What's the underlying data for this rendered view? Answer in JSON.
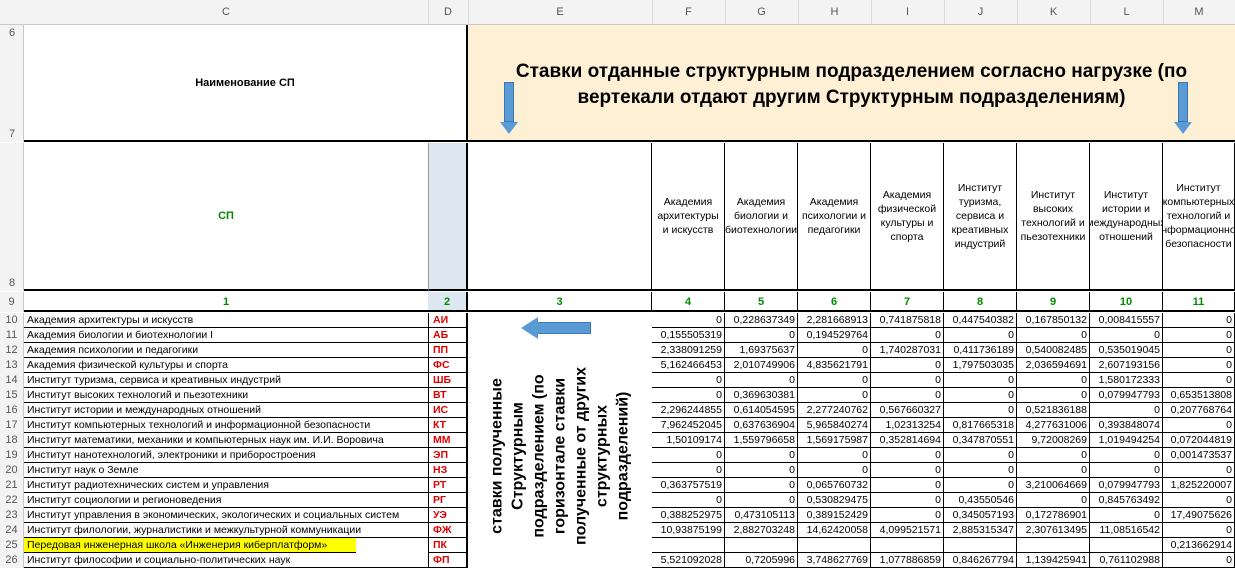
{
  "col_headers": [
    "C",
    "D",
    "E",
    "F",
    "G",
    "H",
    "I",
    "J",
    "K",
    "L",
    "M"
  ],
  "row_numbers": {
    "r6": "6",
    "r7": "7",
    "r8": "8",
    "r9": "9"
  },
  "header": {
    "name_sp": "Наименование СП",
    "sp": "СП",
    "banner_line1": "Ставки отданные структурным подразделением согласно нагрузке (по",
    "banner_line2": "вертекали отдают другим Структурным подразделениям)",
    "vertical_note": "ставки полученные Структурным подразделением (по горизонтале ставки полученные от других структурных подразделений)"
  },
  "columns": [
    {
      "label": "Академия архитектуры и искусств",
      "num": "4"
    },
    {
      "label": "Академия биологии и биотехнологии",
      "num": "5"
    },
    {
      "label": "Академия психологии и педагогики",
      "num": "6"
    },
    {
      "label": "Академия физической культуры и спорта",
      "num": "7"
    },
    {
      "label": "Институт туризма, сервиса и креативных индустрий",
      "num": "8"
    },
    {
      "label": "Институт высоких технологий и пьезотехники",
      "num": "9"
    },
    {
      "label": "Институт истории и международных отношений",
      "num": "10"
    },
    {
      "label": "Институт компьютерных технологий и информационной безопасности",
      "num": "11"
    }
  ],
  "index_row": {
    "c": "1",
    "d": "2",
    "e": "3"
  },
  "rows": [
    {
      "n": "10",
      "name": "Академия архитектуры и искусств",
      "code": "АИ",
      "v": [
        "0",
        "0,228637349",
        "2,281668913",
        "0,741875818",
        "0,447540382",
        "0,167850132",
        "0,008415557",
        "0"
      ]
    },
    {
      "n": "11",
      "name": "Академия биологии и биотехнологии I",
      "code": "АБ",
      "v": [
        "0,155505319",
        "0",
        "0,194529764",
        "0",
        "0",
        "0",
        "0",
        "0"
      ]
    },
    {
      "n": "12",
      "name": "Академия психологии и педагогики",
      "code": "ПП",
      "v": [
        "2,338091259",
        "1,69375637",
        "0",
        "1,740287031",
        "0,411736189",
        "0,540082485",
        "0,535019045",
        "0"
      ]
    },
    {
      "n": "13",
      "name": "Академия физической культуры и спорта",
      "code": "ФС",
      "v": [
        "5,162466453",
        "2,010749906",
        "4,835621791",
        "0",
        "1,797503035",
        "2,036594691",
        "2,607193156",
        "0"
      ]
    },
    {
      "n": "14",
      "name": "Институт туризма, сервиса и креативных индустрий",
      "code": "ШБ",
      "v": [
        "0",
        "0",
        "0",
        "0",
        "0",
        "0",
        "1,580172333",
        "0"
      ]
    },
    {
      "n": "15",
      "name": "Институт высоких технологий и пьезотехники",
      "code": "ВТ",
      "v": [
        "0",
        "0,369630381",
        "0",
        "0",
        "0",
        "0",
        "0,079947793",
        "0,653513808"
      ]
    },
    {
      "n": "16",
      "name": "Институт истории и международных отношений",
      "code": "ИС",
      "v": [
        "2,296244855",
        "0,614054595",
        "2,277240762",
        "0,567660327",
        "0",
        "0,521836188",
        "0",
        "0,207768764"
      ]
    },
    {
      "n": "17",
      "name": "Институт компьютерных технологий и информационной безопасности",
      "code": "КТ",
      "v": [
        "7,962452045",
        "0,637636904",
        "5,965840274",
        "1,02313254",
        "0,817665318",
        "4,277631006",
        "0,393848074",
        "0"
      ]
    },
    {
      "n": "18",
      "name": "Институт математики, механики и компьютерных наук им. И.И. Воровича",
      "code": "ММ",
      "v": [
        "1,50109174",
        "1,559796658",
        "1,569175987",
        "0,352814694",
        "0,347870551",
        "9,72008269",
        "1,019494254",
        "0,072044819"
      ]
    },
    {
      "n": "19",
      "name": "Институт нанотехнологий, электроники и приборостроения",
      "code": "ЭП",
      "v": [
        "0",
        "0",
        "0",
        "0",
        "0",
        "0",
        "0",
        "0,001473537"
      ]
    },
    {
      "n": "20",
      "name": "Институт наук о Земле",
      "code": "НЗ",
      "v": [
        "0",
        "0",
        "0",
        "0",
        "0",
        "0",
        "0",
        "0"
      ]
    },
    {
      "n": "21",
      "name": "Институт радиотехнических систем и управления",
      "code": "РТ",
      "v": [
        "0,363757519",
        "0",
        "0,065760732",
        "0",
        "0",
        "3,210064669",
        "0,079947793",
        "1,825220007"
      ]
    },
    {
      "n": "22",
      "name": "Институт социологии и регионоведения",
      "code": "РГ",
      "v": [
        "0",
        "0",
        "0,530829475",
        "0",
        "0,43550546",
        "0",
        "0,845763492",
        "0"
      ]
    },
    {
      "n": "23",
      "name": "Институт управления в экономических, экологических и социальных систем",
      "code": "УЭ",
      "v": [
        "0,388252975",
        "0,473105113",
        "0,389152429",
        "0",
        "0,345057193",
        "0,172786901",
        "0",
        "17,49075626"
      ]
    },
    {
      "n": "24",
      "name": "Институт филологии, журналистики и межкультурной коммуникации",
      "code": "ФЖ",
      "v": [
        "10,93875199",
        "2,882703248",
        "14,62420058",
        "4,099521571",
        "2,885315347",
        "2,307613495",
        "11,08516542",
        "0"
      ]
    },
    {
      "n": "25",
      "name": "Передовая инженерная школа «Инженерия киберплатформ»",
      "code": "ПК",
      "v": [
        "",
        "",
        "",
        "",
        "",
        "",
        "",
        "0,213662914"
      ]
    },
    {
      "n": "26",
      "name": "Институт философии и социально-политических наук",
      "code": "ФП",
      "v": [
        "5,521092028",
        "0,7205996",
        "3,748627769",
        "1,077886859",
        "0,846267794",
        "1,139425941",
        "0,761102988",
        "0"
      ]
    }
  ],
  "colors": {
    "banner_bg": "#fdf0d5",
    "sp_col_bg": "#dde7f2",
    "highlight": "#ffff00",
    "arrow": "#5b9bd5"
  }
}
